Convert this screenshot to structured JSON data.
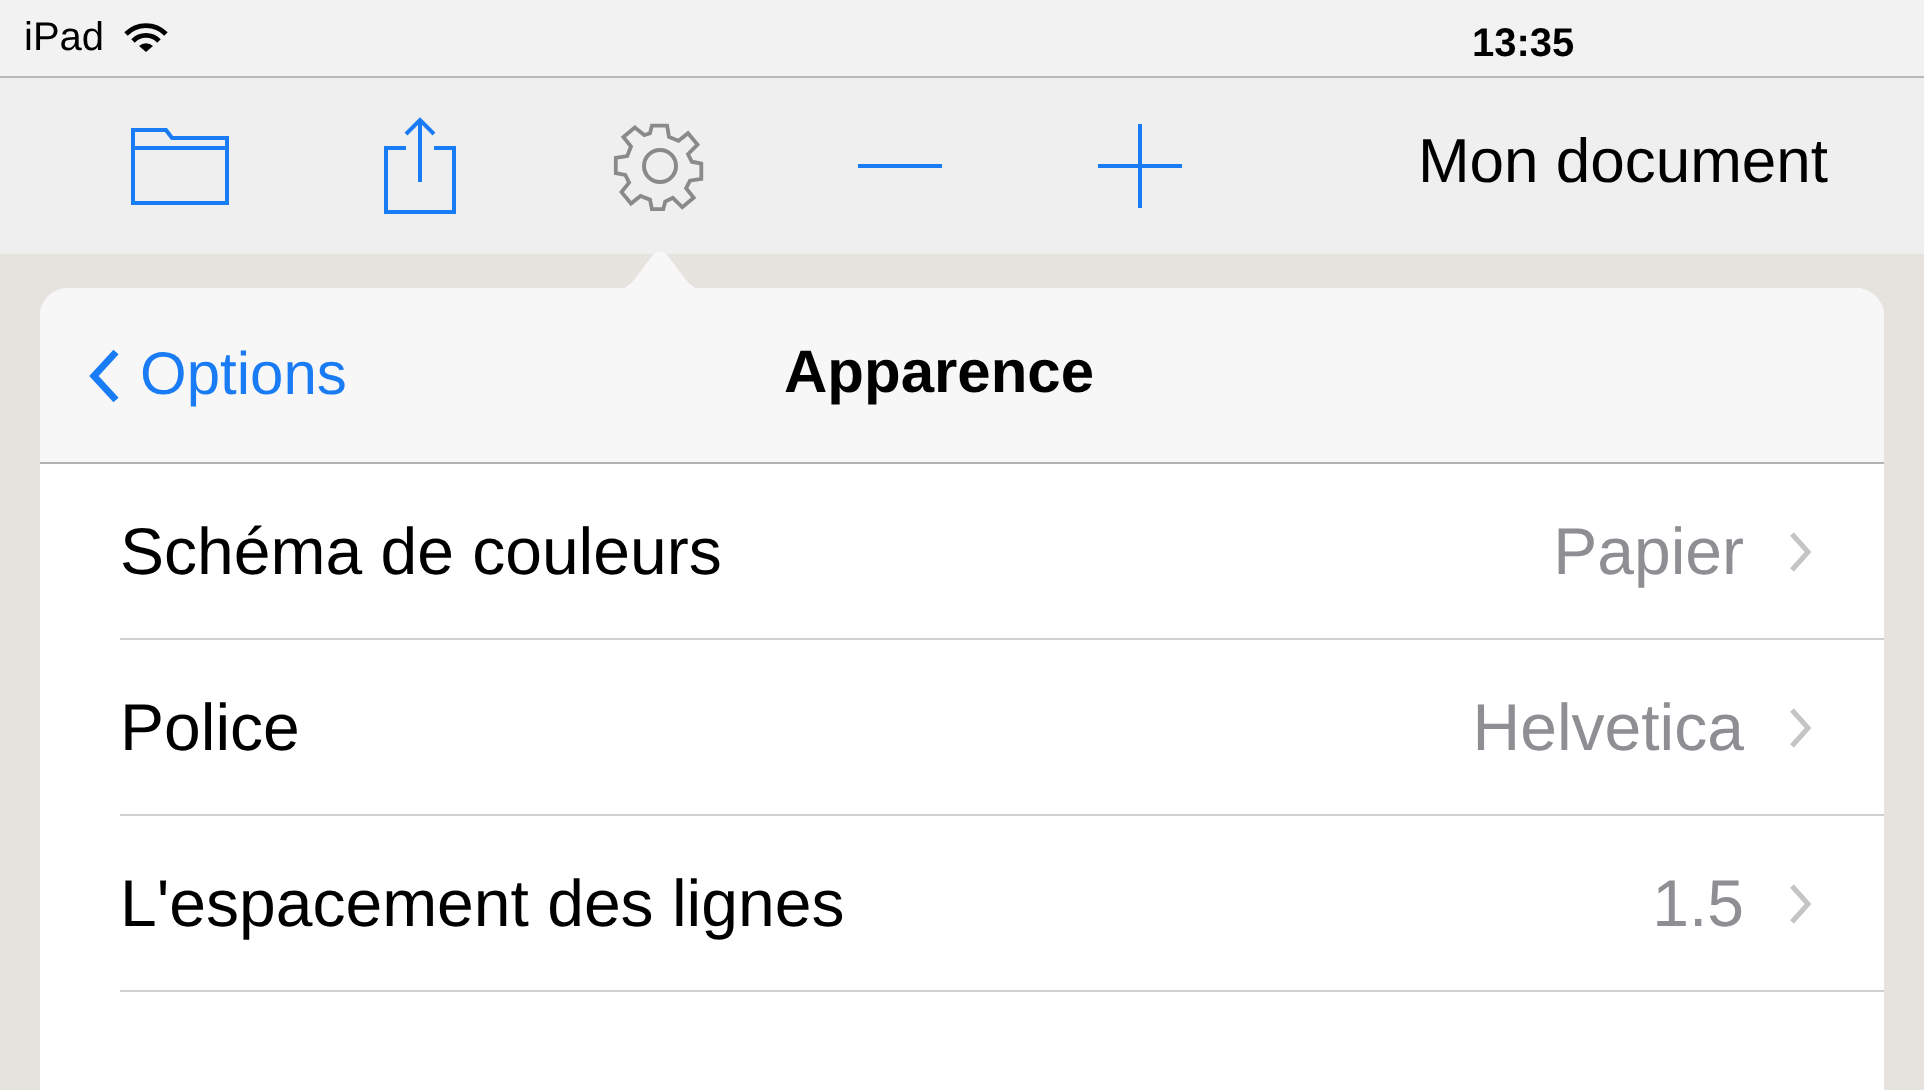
{
  "status_bar": {
    "carrier": "iPad",
    "time": "13:35"
  },
  "toolbar": {
    "document_title": "Mon document"
  },
  "popover": {
    "back_label": "Options",
    "title": "Apparence",
    "rows": [
      {
        "label": "Schéma de couleurs",
        "value": "Papier"
      },
      {
        "label": "Police",
        "value": "Helvetica"
      },
      {
        "label": "L'espacement des lignes",
        "value": "1.5"
      }
    ]
  }
}
